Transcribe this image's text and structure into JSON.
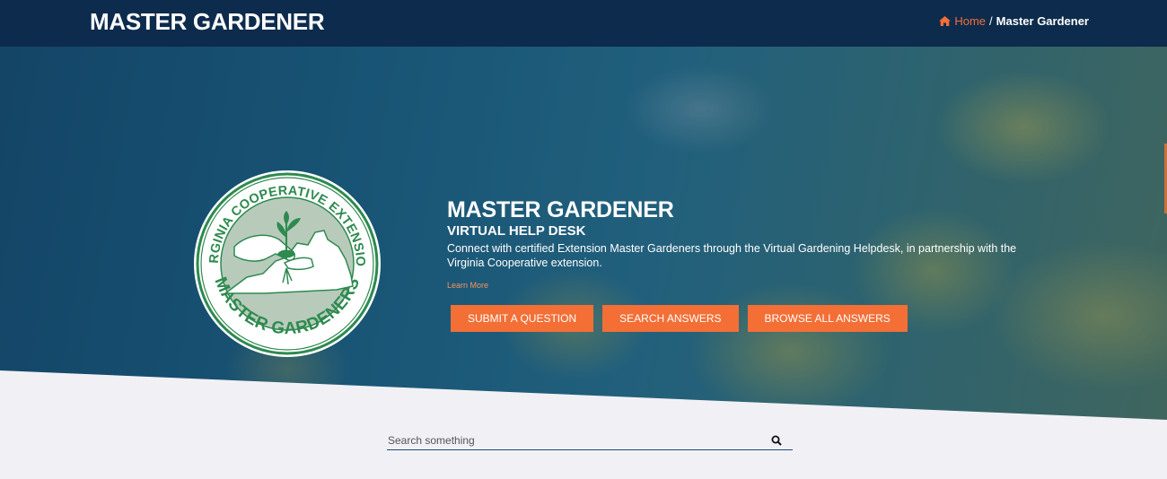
{
  "header": {
    "site_title": "MASTER GARDENER",
    "breadcrumb": {
      "home_label": "Home",
      "separator": "/",
      "current": "Master Gardener"
    }
  },
  "hero": {
    "logo": {
      "top_arc_text": "VIRGINIA COOPERATIVE EXTENSION",
      "bottom_arc_text": "MASTER GARDENERS",
      "icon": "virginia-hands-seedling-logo"
    },
    "title": "MASTER GARDENER",
    "subtitle": "VIRTUAL HELP DESK",
    "description": "Connect with certified Extension Master Gardeners through the Virtual Gardening Helpdesk, in partnership with the Virginia Cooperative extension.",
    "learn_more": "Learn More",
    "buttons": {
      "submit": "SUBMIT A QUESTION",
      "search": "SEARCH ANSWERS",
      "browse": "BROWSE ALL ANSWERS"
    }
  },
  "search": {
    "placeholder": "Search something",
    "value": ""
  },
  "colors": {
    "navy": "#0d2b4c",
    "accent": "#f36f36",
    "logo_green": "#2e8a4f",
    "background": "#f1f1f5"
  }
}
